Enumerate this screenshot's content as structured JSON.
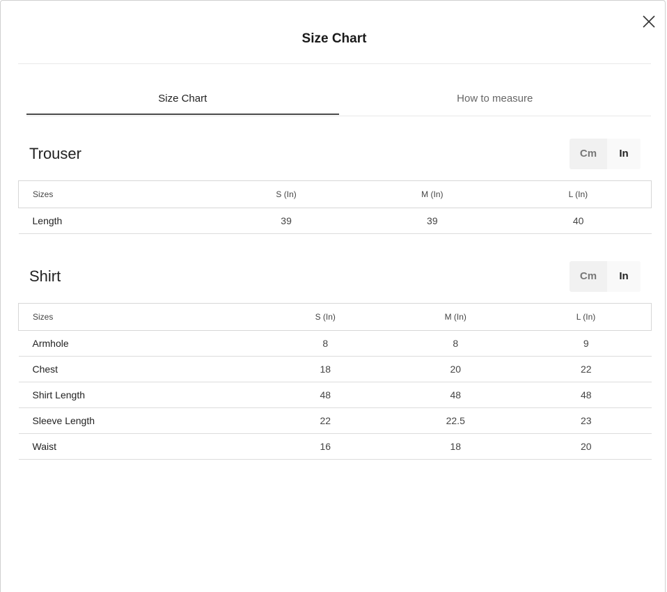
{
  "modal": {
    "title": "Size Chart"
  },
  "tabs": [
    {
      "label": "Size Chart",
      "active": true
    },
    {
      "label": "How to measure",
      "active": false
    }
  ],
  "units": {
    "cm_label": "Cm",
    "in_label": "In",
    "selected": "In"
  },
  "trouser": {
    "title": "Trouser",
    "headers": [
      "Sizes",
      "S (In)",
      "M (In)",
      "L (In)"
    ],
    "rows": [
      [
        "Length",
        "39",
        "39",
        "40"
      ]
    ]
  },
  "shirt": {
    "title": "Shirt",
    "headers": [
      "Sizes",
      "S (In)",
      "M (In)",
      "L (In)"
    ],
    "rows": [
      [
        "Armhole",
        "8",
        "8",
        "9"
      ],
      [
        "Chest",
        "18",
        "20",
        "22"
      ],
      [
        "Shirt Length",
        "48",
        "48",
        "48"
      ],
      [
        "Sleeve Length",
        "22",
        "22.5",
        "23"
      ],
      [
        "Waist",
        "16",
        "18",
        "20"
      ]
    ]
  },
  "icons": {
    "close": "close-icon"
  }
}
